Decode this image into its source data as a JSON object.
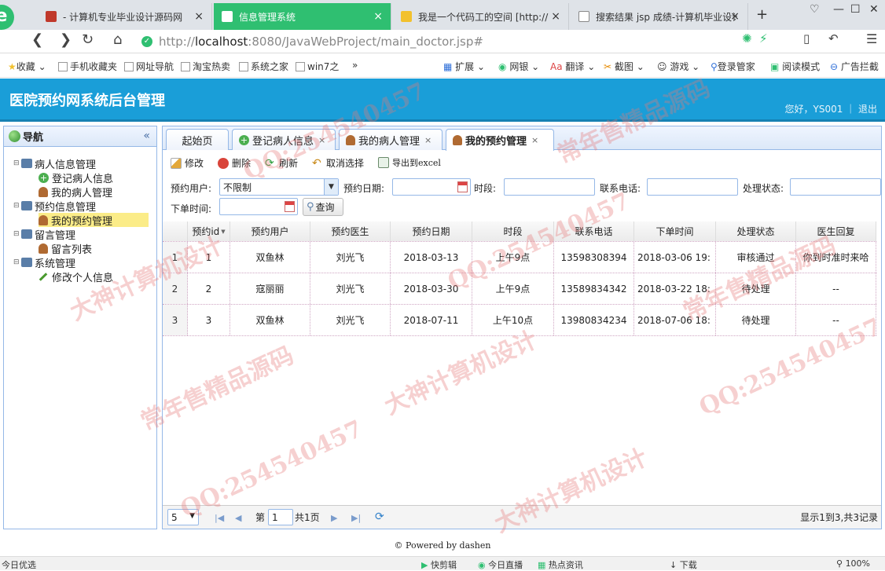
{
  "browser": {
    "tabs": [
      {
        "title": "- 计算机专业毕业设计源码网",
        "active": false
      },
      {
        "title": "信息管理系统",
        "active": true
      },
      {
        "title": "我是一个代码工的空间 [http://",
        "active": false
      },
      {
        "title": "搜索结果 jsp 成绩-计算机毕业设计",
        "active": false
      }
    ],
    "url_prefix": "http://",
    "url_host": "localhost",
    "url_rest": ":8080/JavaWebProject/main_doctor.jsp#",
    "bookmarks": [
      "收藏",
      "手机收藏夹",
      "网址导航",
      "淘宝热卖",
      "系统之家",
      "win7之",
      "»",
      "扩展",
      "网银",
      "翻译",
      "截图",
      "游戏",
      "登录管家",
      "阅读模式",
      "广告拦截"
    ]
  },
  "app": {
    "title": "医院预约网系统后台管理",
    "greeting": "您好，YS001 ｜ 退出"
  },
  "nav": {
    "title": "导航",
    "groups": [
      {
        "label": "病人信息管理",
        "items": [
          "登记病人信息",
          "我的病人管理"
        ]
      },
      {
        "label": "预约信息管理",
        "items": [
          "我的预约管理"
        ]
      },
      {
        "label": "留言管理",
        "items": [
          "留言列表"
        ]
      },
      {
        "label": "系统管理",
        "items": [
          "修改个人信息"
        ]
      }
    ]
  },
  "content_tabs": [
    "起始页",
    "登记病人信息",
    "我的病人管理",
    "我的预约管理"
  ],
  "toolbar": {
    "edit": "修改",
    "delete": "删除",
    "refresh": "刷新",
    "cancel_select": "取消选择",
    "export": "导出到excel"
  },
  "filters": {
    "user_label": "预约用户:",
    "user_value": "不限制",
    "date_label": "预约日期:",
    "period_label": "时段:",
    "phone_label": "联系电话:",
    "status_label": "处理状态:",
    "order_time_label": "下单时间:",
    "query": "查询"
  },
  "grid": {
    "headers": [
      "预约id",
      "预约用户",
      "预约医生",
      "预约日期",
      "时段",
      "联系电话",
      "下单时间",
      "处理状态",
      "医生回复"
    ],
    "rows": [
      {
        "num": "1",
        "cells": [
          "1",
          "双鱼林",
          "刘光飞",
          "2018-03-13",
          "上午9点",
          "13598308394",
          "2018-03-06 19:",
          "审核通过",
          "你到时准时来哈"
        ]
      },
      {
        "num": "2",
        "cells": [
          "2",
          "寇丽丽",
          "刘光飞",
          "2018-03-30",
          "上午9点",
          "13589834342",
          "2018-03-22 18:",
          "待处理",
          "--"
        ]
      },
      {
        "num": "3",
        "cells": [
          "3",
          "双鱼林",
          "刘光飞",
          "2018-07-11",
          "上午10点",
          "13980834234",
          "2018-07-06 18:",
          "待处理",
          "--"
        ]
      }
    ]
  },
  "pager": {
    "page_size": "5",
    "page_prefix": "第",
    "page_value": "1",
    "page_total": "共1页",
    "summary": "显示1到3,共3记录"
  },
  "footer": "© Powered by dashen",
  "statusbar": {
    "left": "今日优选",
    "items": [
      "快剪辑",
      "今日直播",
      "热点资讯",
      "下载",
      "100%"
    ]
  },
  "watermarks": [
    "QQ:254540457",
    "常年售精品源码",
    "大神计算机设计"
  ]
}
